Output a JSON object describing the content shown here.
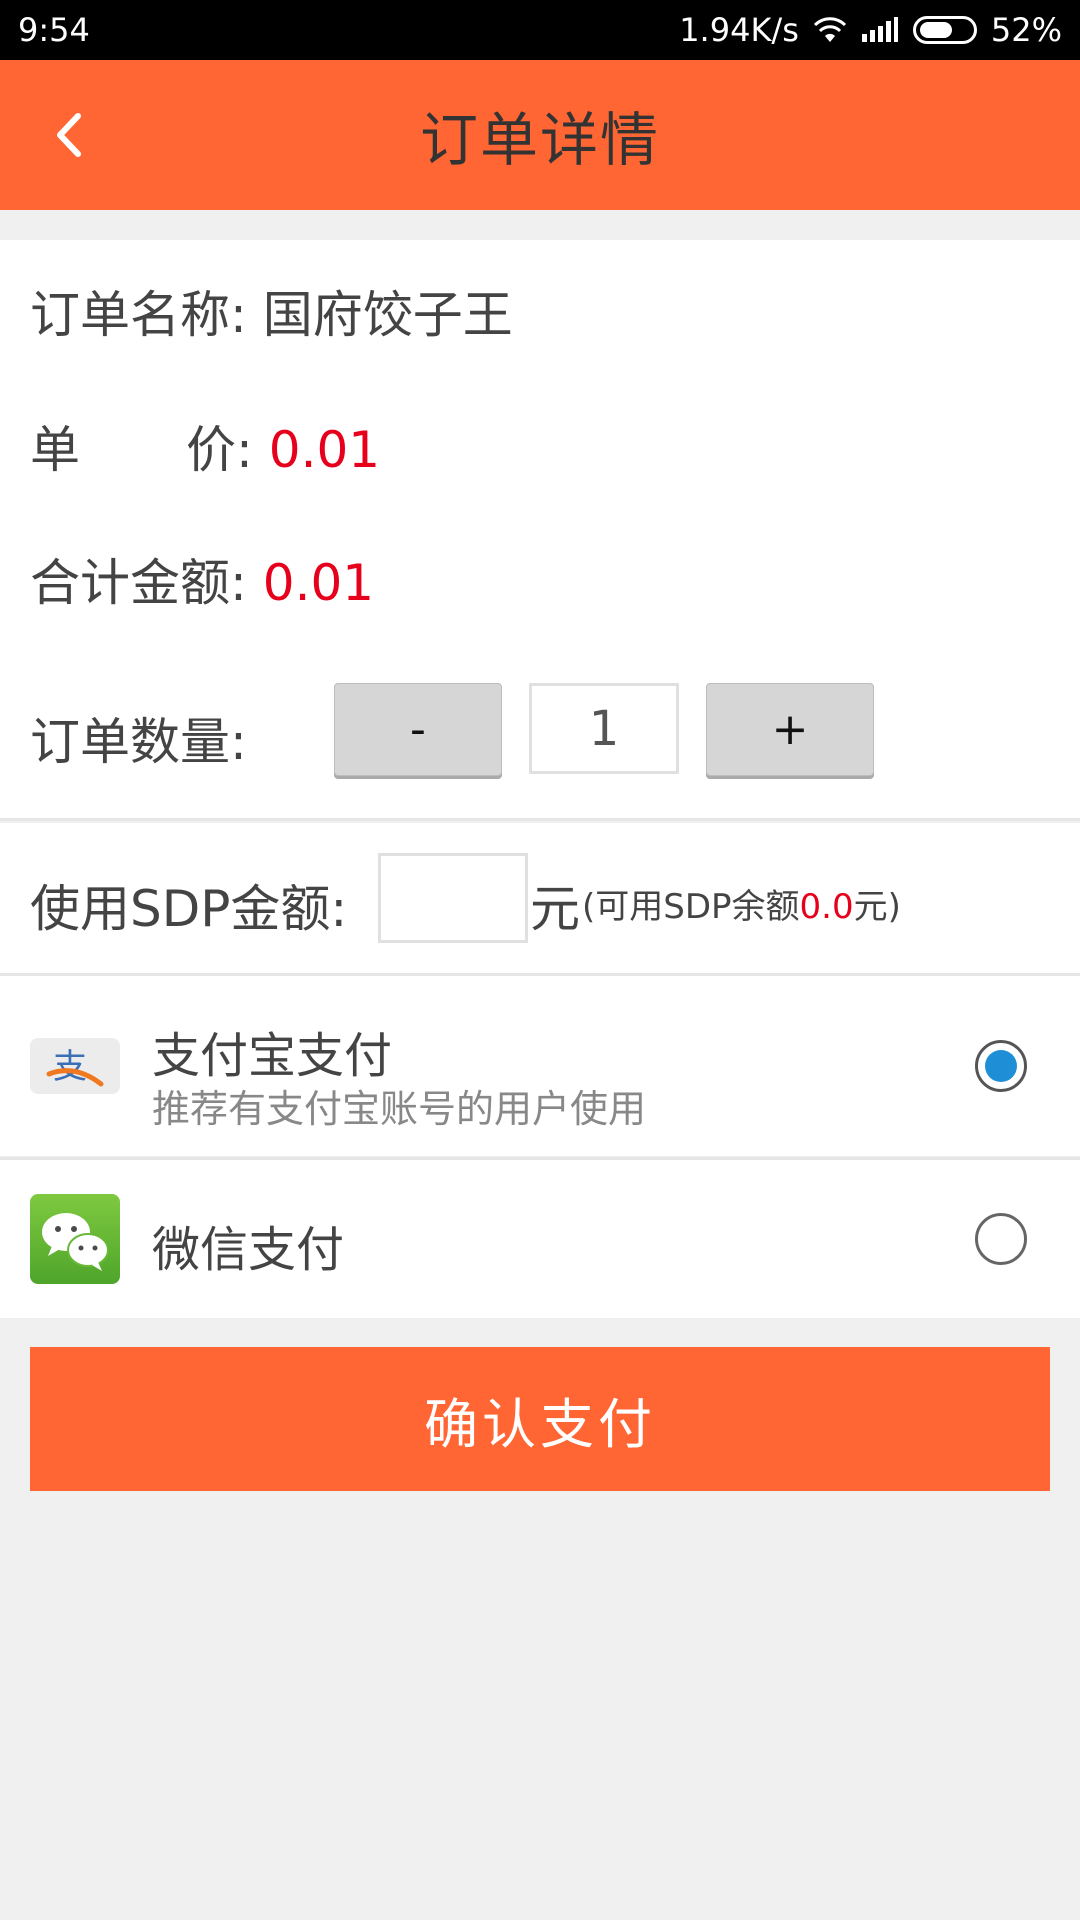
{
  "status_bar": {
    "time": "9:54",
    "network_speed": "1.94K/s",
    "battery": "52%",
    "icons": [
      "wifi-icon",
      "signal-icon",
      "battery-icon"
    ]
  },
  "header": {
    "title": "订单详情",
    "back_icon": "chevron-left-icon"
  },
  "order": {
    "name_label": "订单名称:",
    "name_value": "国府饺子王",
    "unit_price_label_1": "单",
    "unit_price_label_2": "价:",
    "unit_price_value": "0.01",
    "total_label": "合计金额:",
    "total_value": "0.01",
    "quantity_label": "订单数量:",
    "decrement_label": "-",
    "quantity_value": "1",
    "increment_label": "+"
  },
  "sdp": {
    "label": "使用SDP金额:",
    "input_value": "",
    "unit": "元",
    "note_prefix": "(可用SDP余额",
    "balance": "0.0",
    "note_suffix": "元)"
  },
  "payment_methods": [
    {
      "name": "支付宝支付",
      "description": "推荐有支付宝账号的用户使用",
      "icon": "alipay-icon",
      "selected": true
    },
    {
      "name": "微信支付",
      "description": "",
      "icon": "wechat-icon",
      "selected": false
    }
  ],
  "confirm_label": "确认支付",
  "colors": {
    "accent": "#ff6633",
    "price_red": "#e6001c",
    "radio_selected": "#1e8fd6",
    "background": "#f0f0f0"
  }
}
